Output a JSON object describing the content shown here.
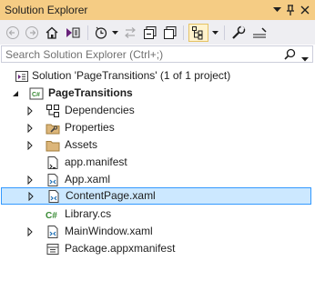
{
  "window": {
    "title": "Solution Explorer"
  },
  "search": {
    "placeholder": "Search Solution Explorer (Ctrl+;)"
  },
  "tree": {
    "solution": "Solution 'PageTransitions' (1 of 1 project)",
    "project": "PageTransitions",
    "items": [
      {
        "label": "Dependencies",
        "icon": "dependencies-icon"
      },
      {
        "label": "Properties",
        "icon": "wrench-folder-icon"
      },
      {
        "label": "Assets",
        "icon": "folder-icon"
      },
      {
        "label": "app.manifest",
        "icon": "manifest-file-icon"
      },
      {
        "label": "App.xaml",
        "icon": "xaml-file-icon"
      },
      {
        "label": "ContentPage.xaml",
        "icon": "xaml-file-icon",
        "selected": true
      },
      {
        "label": "Library.cs",
        "icon": "csharp-file-icon"
      },
      {
        "label": "MainWindow.xaml",
        "icon": "xaml-file-icon"
      },
      {
        "label": "Package.appxmanifest",
        "icon": "package-manifest-icon"
      }
    ]
  },
  "colors": {
    "title_bar": "#f5cc84",
    "toolbar": "#eeeef2",
    "selection": "#cce8ff",
    "selection_border": "#3399ff",
    "accent": "#68217a"
  }
}
